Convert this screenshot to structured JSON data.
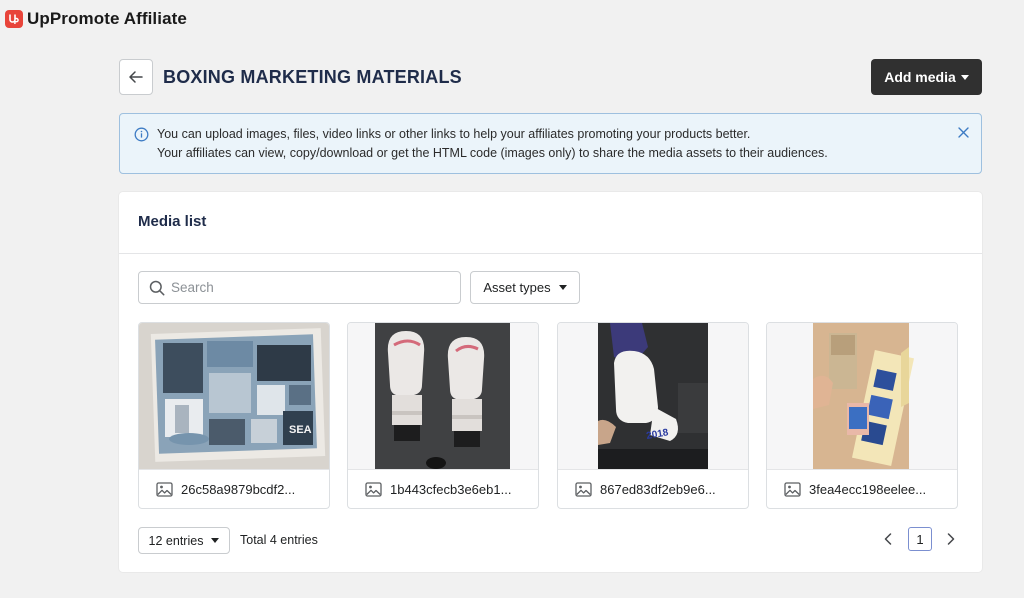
{
  "app": {
    "title": "UpPromote Affiliate",
    "logo_icon": "uppromote-logo-icon",
    "brand_color": "#e8443a"
  },
  "header": {
    "title": "BOXING MARKETING MATERIALS",
    "back_icon": "arrow-left-icon",
    "add_media_label": "Add media"
  },
  "banner": {
    "line1": "You can upload images, files, video links or other links to help your affiliates promoting your products better.",
    "line2": "Your affiliates can view, copy/download or get the HTML code (images only) to share the media assets to their audiences.",
    "info_icon": "info-icon",
    "close_icon": "close-icon"
  },
  "media_list": {
    "title": "Media list",
    "search_placeholder": "Search",
    "asset_types_label": "Asset types",
    "items": [
      {
        "name": "26c58a9879bcdf2...",
        "icon": "image-icon"
      },
      {
        "name": "1b443cfecb3e6eb1...",
        "icon": "image-icon"
      },
      {
        "name": "867ed83df2eb9e6...",
        "icon": "image-icon"
      },
      {
        "name": "3fea4ecc198eelee...",
        "icon": "image-icon"
      }
    ]
  },
  "footer": {
    "entries_label": "12 entries",
    "total_label": "Total 4 entries",
    "current_page": "1"
  }
}
